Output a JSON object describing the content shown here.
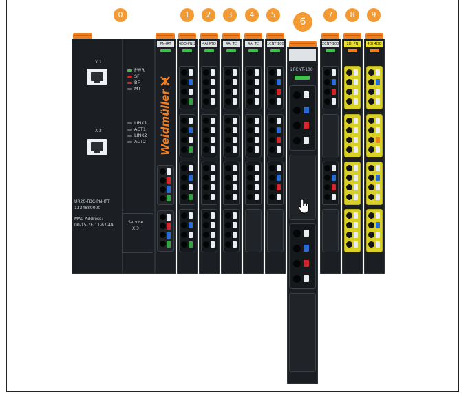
{
  "badges": [
    "0",
    "1",
    "2",
    "3",
    "4",
    "5",
    "6",
    "7",
    "8",
    "9"
  ],
  "coupler": {
    "ports": [
      "X 1",
      "X 2"
    ],
    "status_leds": [
      {
        "label": "PWR",
        "color": "#3ec04a"
      },
      {
        "label": "SF",
        "color": "#d3262b"
      },
      {
        "label": "BF",
        "color": "#d3262b"
      },
      {
        "label": "MT",
        "color": "#5c6166"
      }
    ],
    "link_leds": [
      "LINK1",
      "ACT1",
      "LINK2",
      "ACT2"
    ],
    "model": "UR20-FBC-PN-IRT",
    "serial": "1334880000",
    "mac_label": "MAC-Address:",
    "mac": "00-15-7E-11-67-4A",
    "service_label": "Service",
    "service_port": "X 3"
  },
  "brand_module": {
    "header": "PN-IRT",
    "brand": "Weidmüller"
  },
  "modules": [
    {
      "header": "4DO-PN 2A"
    },
    {
      "header": "4AI RTD"
    },
    {
      "header": "4AI TC"
    },
    {
      "header": "4AI TC"
    },
    {
      "header": "1CNT 100"
    },
    {
      "header": "2FCNT-100"
    },
    {
      "header": "2CNT-100"
    },
    {
      "header": "2DI PN"
    },
    {
      "header": "4DI 4DO"
    }
  ],
  "colors": {
    "accent": "#f07f22",
    "badge": "#f39a32",
    "module_body": "#1b1f23",
    "yellow_terminal": "#e9de2e"
  },
  "icons": [
    "hand-pointer-icon",
    "weidmuller-logo-icon"
  ]
}
